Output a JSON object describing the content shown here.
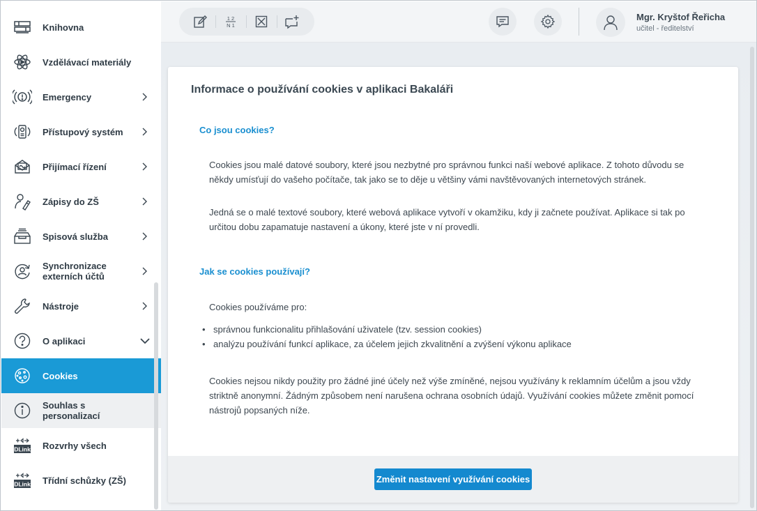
{
  "sidebar": {
    "items": [
      {
        "label": "Knihovna",
        "icon": "library-icon",
        "chevron": "none"
      },
      {
        "label": "Vzdělávací materiály",
        "icon": "atom-icon",
        "chevron": "none"
      },
      {
        "label": "Emergency",
        "icon": "emergency-icon",
        "chevron": "right"
      },
      {
        "label": "Přístupový systém",
        "icon": "access-system-icon",
        "chevron": "right"
      },
      {
        "label": "Přijímací řízení",
        "icon": "admission-icon",
        "chevron": "right"
      },
      {
        "label": "Zápisy do ZŠ",
        "icon": "enrollment-icon",
        "chevron": "right"
      },
      {
        "label": "Spisová služba",
        "icon": "filing-icon",
        "chevron": "right"
      },
      {
        "label": "Synchronizace externích účtů",
        "icon": "sync-accounts-icon",
        "chevron": "right"
      },
      {
        "label": "Nástroje",
        "icon": "wrench-icon",
        "chevron": "right"
      },
      {
        "label": "O aplikaci",
        "icon": "question-icon",
        "chevron": "down"
      },
      {
        "label": "Cookies",
        "icon": "cookie-icon",
        "chevron": "none"
      },
      {
        "label": "Souhlas s personalizací",
        "icon": "info-icon",
        "chevron": "none"
      },
      {
        "label": "Rozvrhy všech",
        "icon": "dlink-icon",
        "chevron": "none"
      },
      {
        "label": "Třídní schůzky (ZŠ)",
        "icon": "dlink-icon",
        "chevron": "none"
      }
    ],
    "active_index": 10,
    "hover_index": 11
  },
  "header": {
    "tools": [
      "edit-icon",
      "grades-icon",
      "absence-icon",
      "add-message-icon"
    ],
    "grades_glyph_top": "1 2",
    "grades_glyph_bottom": "N 1",
    "user": {
      "name": "Mgr. Kryštof Řeřicha",
      "role": "učitel - ředitelství"
    }
  },
  "card": {
    "title": "Informace o používání cookies v aplikaci Bakaláři",
    "section1_heading": "Co jsou cookies?",
    "section1_p1": "Cookies jsou malé datové soubory, které jsou nezbytné pro správnou funkci naší webové aplikace. Z tohoto důvodu se někdy umísťují do vašeho počítače, tak jako se to děje u většiny vámi navštěvovaných internetových stránek.",
    "section1_p2": "Jedná se o malé textové soubory, které webová aplikace vytvoří v okamžiku, kdy ji začnete používat. Aplikace si tak po určitou dobu zapamatuje nastavení a úkony, které jste v ní provedli.",
    "section2_heading": "Jak se cookies používají?",
    "section2_intro": "Cookies používáme pro:",
    "section2_bullets": [
      "správnou funkcionalitu přihlašování uživatele (tzv. session cookies)",
      "analýzu používání funkcí aplikace, za účelem jejich zkvalitnění a zvýšení výkonu aplikace"
    ],
    "section2_p2": "Cookies nejsou nikdy použity pro žádné jiné účely než výše zmíněné, nejsou využívány k reklamním účelům a jsou vždy striktně anonymní. Žádným způsobem není narušena ochrana osobních údajů. Využívání cookies můžete změnit pomocí nástrojů popsaných níže.",
    "button_label": "Změnit nastavení využívání cookies"
  },
  "colors": {
    "accent": "#1a9ad6",
    "heading_blue": "#1a8fd0",
    "button_blue": "#1489cf"
  }
}
